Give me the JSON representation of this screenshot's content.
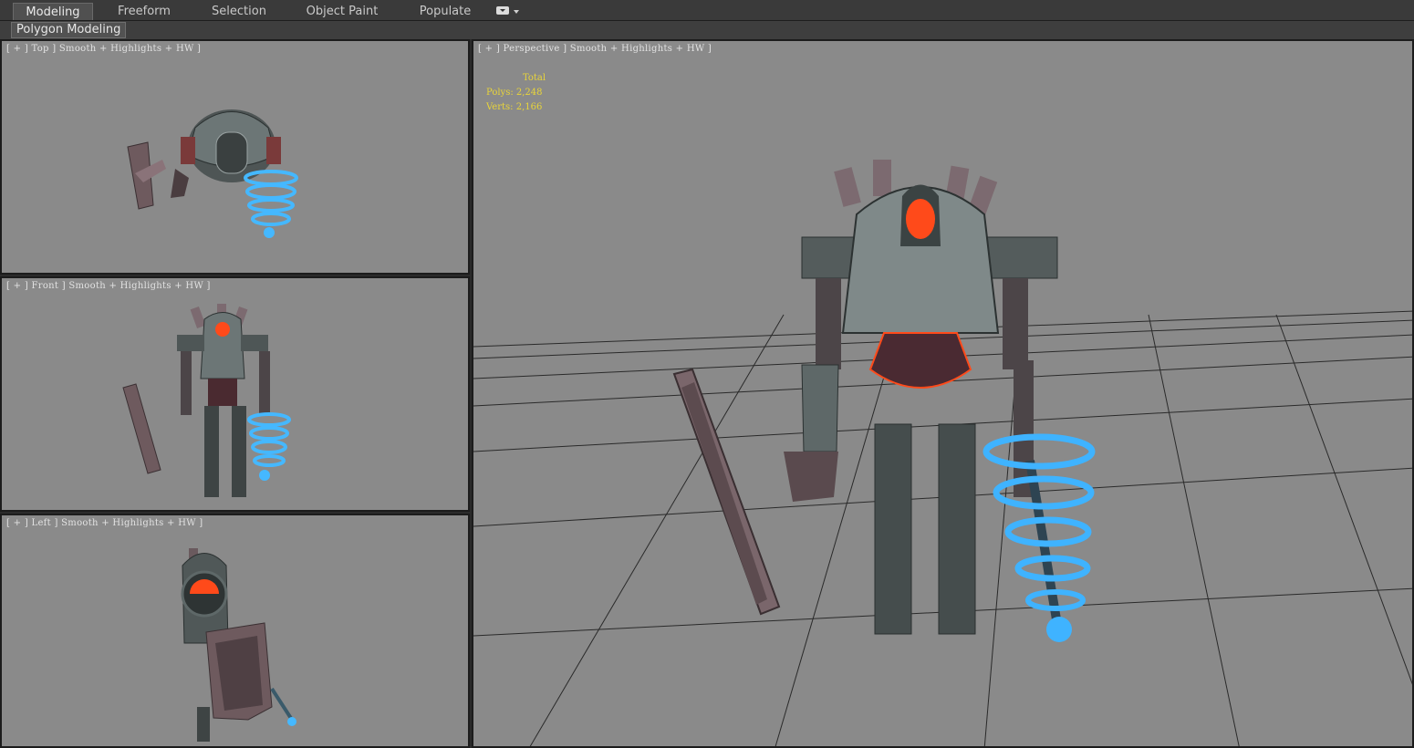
{
  "ribbon": {
    "tabs": [
      "Modeling",
      "Freeform",
      "Selection",
      "Object Paint",
      "Populate"
    ]
  },
  "subbar": {
    "label": "Polygon Modeling"
  },
  "viewports": {
    "top": {
      "label": "[ + ] Top ] Smooth + Highlights + HW ]"
    },
    "front": {
      "label": "[ + ] Front ] Smooth + Highlights + HW ]"
    },
    "left": {
      "label": "[ + ] Left ] Smooth + Highlights + HW ]"
    },
    "perspective": {
      "label": "[ + ] Perspective ] Smooth + Highlights + HW ]"
    }
  },
  "stats": {
    "title": "Total",
    "polys": "Polys: 2,248",
    "verts": "Verts: 2,166"
  },
  "colors": {
    "viewport_bg": "#8a8a8a",
    "stats_text": "#e8d43a",
    "robot_accent": "#ff4a1a",
    "energy_rings": "#3fb3ff"
  }
}
